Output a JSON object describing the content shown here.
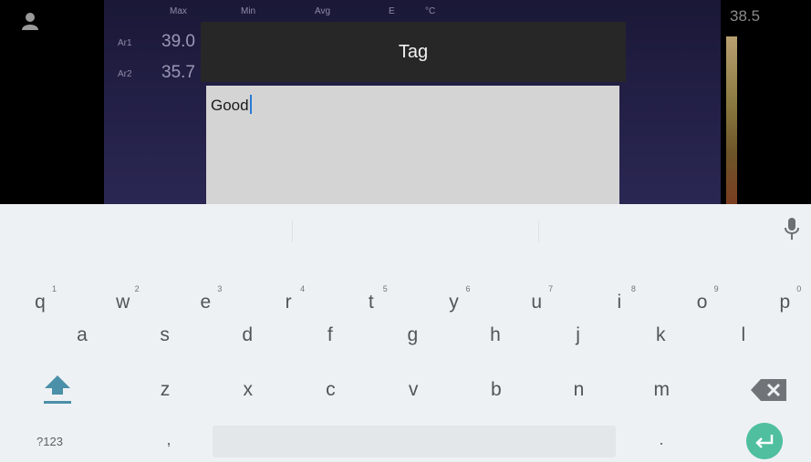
{
  "app": {
    "temperature_display": "38.5",
    "columns": [
      "Max",
      "Min",
      "Avg",
      "E",
      "°C"
    ],
    "rows": [
      {
        "label": "Ar1",
        "value": "39.0"
      },
      {
        "label": "Ar2",
        "value": "35.7"
      }
    ],
    "user_icon": "user-icon",
    "colors": {
      "scale_top": "#b9a071",
      "scale_bottom": "#7a3d20"
    }
  },
  "dialog": {
    "title": "Tag",
    "field_value": "Good"
  },
  "keyboard": {
    "mic_icon": "microphone-icon",
    "row1": [
      {
        "key": "q",
        "hint": "1"
      },
      {
        "key": "w",
        "hint": "2"
      },
      {
        "key": "e",
        "hint": "3"
      },
      {
        "key": "r",
        "hint": "4"
      },
      {
        "key": "t",
        "hint": "5"
      },
      {
        "key": "y",
        "hint": "6"
      },
      {
        "key": "u",
        "hint": "7"
      },
      {
        "key": "i",
        "hint": "8"
      },
      {
        "key": "o",
        "hint": "9"
      },
      {
        "key": "p",
        "hint": "0"
      }
    ],
    "row2": [
      "a",
      "s",
      "d",
      "f",
      "g",
      "h",
      "j",
      "k",
      "l"
    ],
    "row3": [
      "z",
      "x",
      "c",
      "v",
      "b",
      "n",
      "m"
    ],
    "mode_label": "?123",
    "comma": ",",
    "period": ".",
    "shift_icon": "shift-icon",
    "backspace_icon": "backspace-icon",
    "enter_icon": "enter-icon",
    "accent_color": "#4fbf9f"
  }
}
